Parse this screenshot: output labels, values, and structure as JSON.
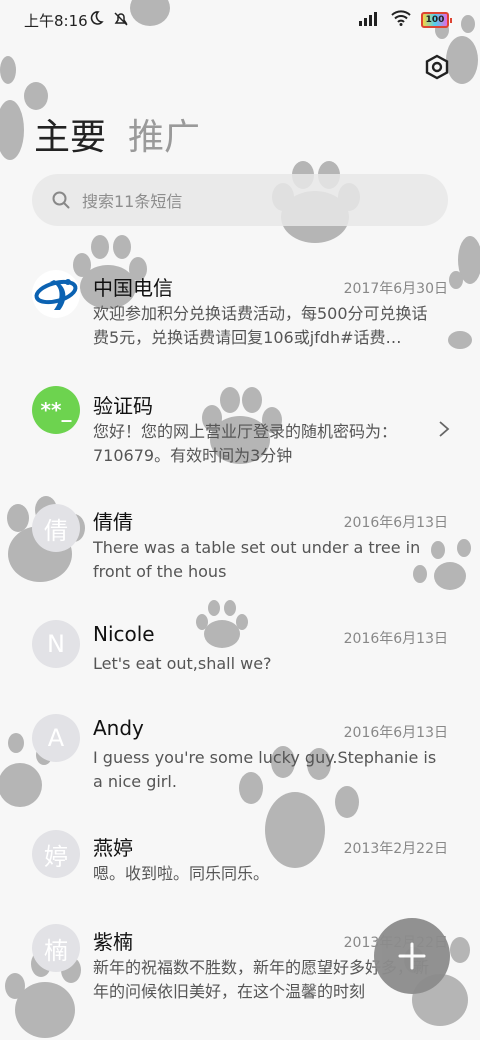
{
  "status_bar": {
    "time": "上午8:16",
    "battery": "100"
  },
  "tabs": {
    "main": "主要",
    "promo": "推广"
  },
  "search": {
    "placeholder": "搜索11条短信"
  },
  "conversations": [
    {
      "name": "中国电信",
      "date": "2017年6月30日",
      "preview": "欢迎参加积分兑换话费活动，每500分可兑换话费5元，兑换话费请回复106或jfdh#话费…",
      "avatar": "telecom-logo-icon"
    },
    {
      "name": "验证码",
      "date": "",
      "preview": "您好！您的网上营业厅登录的随机密码为：710679。有效时间为3分钟",
      "avatar": "**_"
    },
    {
      "name": "倩倩",
      "date": "2016年6月13日",
      "preview": "There was a table set out under a tree in front of the hous",
      "avatar": "倩"
    },
    {
      "name": "Nicole",
      "date": "2016年6月13日",
      "preview": "Let's eat out,shall we?",
      "avatar": "N"
    },
    {
      "name": "Andy",
      "date": "2016年6月13日",
      "preview": "I guess you're some lucky guy.Stephanie is a nice girl.",
      "avatar": "A"
    },
    {
      "name": "燕婷",
      "date": "2013年2月22日",
      "preview": "嗯。收到啦。同乐同乐。",
      "avatar": "婷"
    },
    {
      "name": "紫楠",
      "date": "2013年2月22日",
      "preview": "新年的祝福数不胜数，新年的愿望好多好多，新年的问候依旧美好，在这个温馨的时刻",
      "avatar": "楠"
    }
  ],
  "colors": {
    "verify_avatar": "#6dd34f",
    "letter_avatar": "#e2e2e6",
    "telecom_blue": "#0b62b2",
    "fab": "#8c8c8c"
  },
  "fab": {
    "icon": "plus-icon"
  }
}
